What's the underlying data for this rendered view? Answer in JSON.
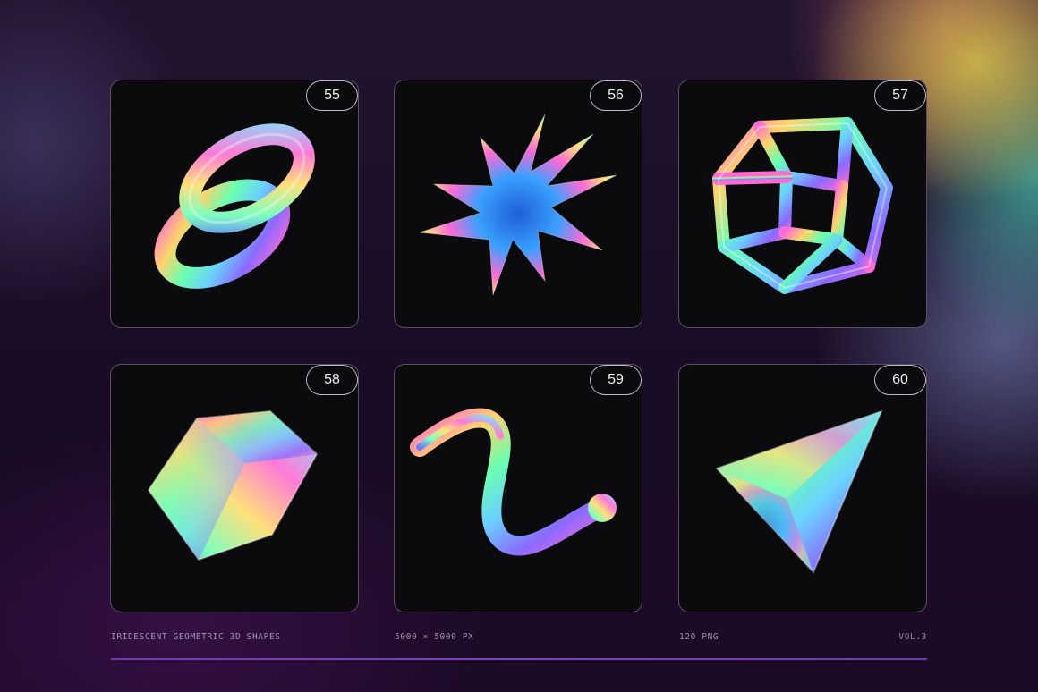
{
  "cards": [
    {
      "number": "55",
      "shape": "linked-torus-rings"
    },
    {
      "number": "56",
      "shape": "spiky-star"
    },
    {
      "number": "57",
      "shape": "wireframe-cube"
    },
    {
      "number": "58",
      "shape": "hexagonal-prism"
    },
    {
      "number": "59",
      "shape": "curved-horn"
    },
    {
      "number": "60",
      "shape": "triangular-pyramid"
    }
  ],
  "footer": {
    "title": "IRIDESCENT GEOMETRIC 3D SHAPES",
    "resolution": "5000 × 5000 PX",
    "count": "120 PNG",
    "volume": "VOL.3"
  },
  "colors": {
    "background": "#1a0d26",
    "card": "#0b0a0c",
    "accent_rule": "#7a48b8"
  }
}
